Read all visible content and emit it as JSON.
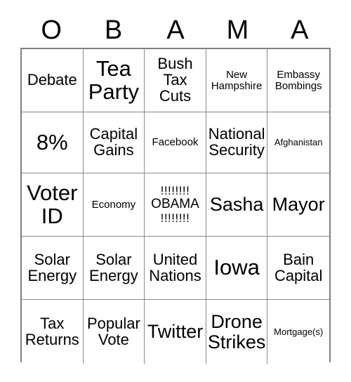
{
  "card": {
    "header_letters": [
      "O",
      "B",
      "A",
      "M",
      "A"
    ],
    "columns": 5,
    "rows": 5,
    "free_space": {
      "row": 3,
      "column": 3,
      "top_marks": "!!!!!!!!",
      "word": "OBAMA",
      "bottom_marks": "!!!!!!!!"
    },
    "colors": {
      "background": "#ffffff",
      "text": "#000000",
      "grid_line": "#8a8a8a",
      "grid_border": "#808080"
    },
    "cells": [
      {
        "text": "Debate",
        "size": "fs-l"
      },
      {
        "text": "Tea Party",
        "size": "fs-xxl"
      },
      {
        "text": "Bush Tax Cuts",
        "size": "fs-l"
      },
      {
        "text": "New Hampshire",
        "size": "fs-s"
      },
      {
        "text": "Embassy Bombings",
        "size": "fs-s"
      },
      {
        "text": "8%",
        "size": "fs-xxl"
      },
      {
        "text": "Capital Gains",
        "size": "fs-l"
      },
      {
        "text": "Facebook",
        "size": "fs-s"
      },
      {
        "text": "National Security",
        "size": "fs-l"
      },
      {
        "text": "Afghanistan",
        "size": "fs-xs"
      },
      {
        "text": "Voter ID",
        "size": "fs-xxl"
      },
      {
        "text": "Economy",
        "size": "fs-s"
      },
      {
        "text": "__FREE__",
        "size": "fs-m"
      },
      {
        "text": "Sasha",
        "size": "fs-xl"
      },
      {
        "text": "Mayor",
        "size": "fs-xl"
      },
      {
        "text": "Solar Energy",
        "size": "fs-l"
      },
      {
        "text": "Solar Energy",
        "size": "fs-l"
      },
      {
        "text": "United Nations",
        "size": "fs-l"
      },
      {
        "text": "Iowa",
        "size": "fs-xxl"
      },
      {
        "text": "Bain Capital",
        "size": "fs-l"
      },
      {
        "text": "Tax Returns",
        "size": "fs-l"
      },
      {
        "text": "Popular Vote",
        "size": "fs-l"
      },
      {
        "text": "Twitter",
        "size": "fs-xl"
      },
      {
        "text": "Drone Strikes",
        "size": "fs-xl"
      },
      {
        "text": "Mortgage(s)",
        "size": "fs-xs"
      }
    ]
  }
}
